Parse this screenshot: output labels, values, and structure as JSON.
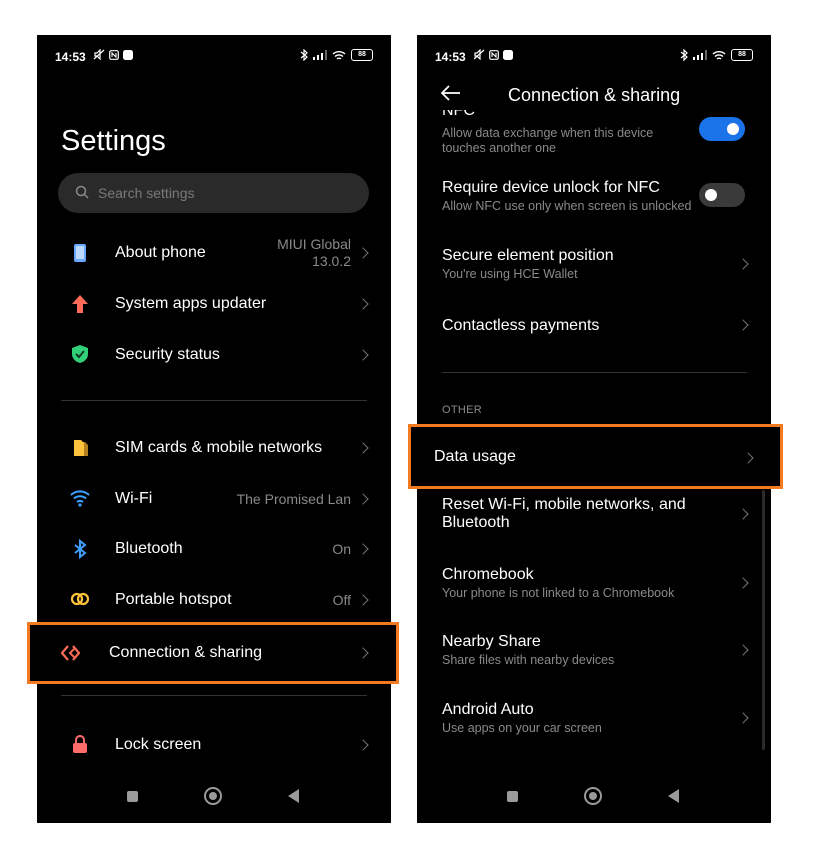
{
  "colors": {
    "highlight": "#f47a1f",
    "toggle_on": "#1a73e8",
    "toggle_off": "#3a3a3a"
  },
  "status_bar": {
    "time": "14:53",
    "battery": "88"
  },
  "left": {
    "title": "Settings",
    "search_placeholder": "Search settings",
    "items": [
      {
        "label": "About phone",
        "value_line1": "MIUI Global",
        "value_line2": "13.0.2",
        "icon": "phone-info-icon"
      },
      {
        "label": "System apps updater",
        "icon": "arrow-up-icon"
      },
      {
        "label": "Security status",
        "icon": "shield-check-icon"
      },
      {
        "label": "SIM cards & mobile networks",
        "icon": "sim-card-icon"
      },
      {
        "label": "Wi-Fi",
        "value": "The Promised Lan",
        "icon": "wifi-icon"
      },
      {
        "label": "Bluetooth",
        "value": "On",
        "icon": "bluetooth-icon"
      },
      {
        "label": "Portable hotspot",
        "value": "Off",
        "icon": "hotspot-icon"
      },
      {
        "label": "Connection & sharing",
        "icon": "connection-sharing-icon"
      },
      {
        "label": "Lock screen",
        "icon": "lock-icon"
      }
    ]
  },
  "right": {
    "title": "Connection & sharing",
    "partial_title": "NFC",
    "items": [
      {
        "subtitle": "Allow data exchange when this device touches another one",
        "toggle": true
      },
      {
        "title": "Require device unlock for NFC",
        "subtitle": "Allow NFC use only when screen is unlocked",
        "toggle": false
      },
      {
        "title": "Secure element position",
        "subtitle": "You're using HCE Wallet"
      },
      {
        "title": "Contactless payments"
      },
      {
        "title": "Data usage"
      },
      {
        "title_line1": "Reset Wi-Fi, mobile networks, and",
        "title_line2": "Bluetooth"
      },
      {
        "title": "Chromebook",
        "subtitle": "Your phone is not linked to a Chromebook"
      },
      {
        "title": "Nearby Share",
        "subtitle": "Share files with nearby devices"
      },
      {
        "title": "Android Auto",
        "subtitle": "Use apps on your car screen"
      }
    ],
    "section_other": "OTHER"
  }
}
